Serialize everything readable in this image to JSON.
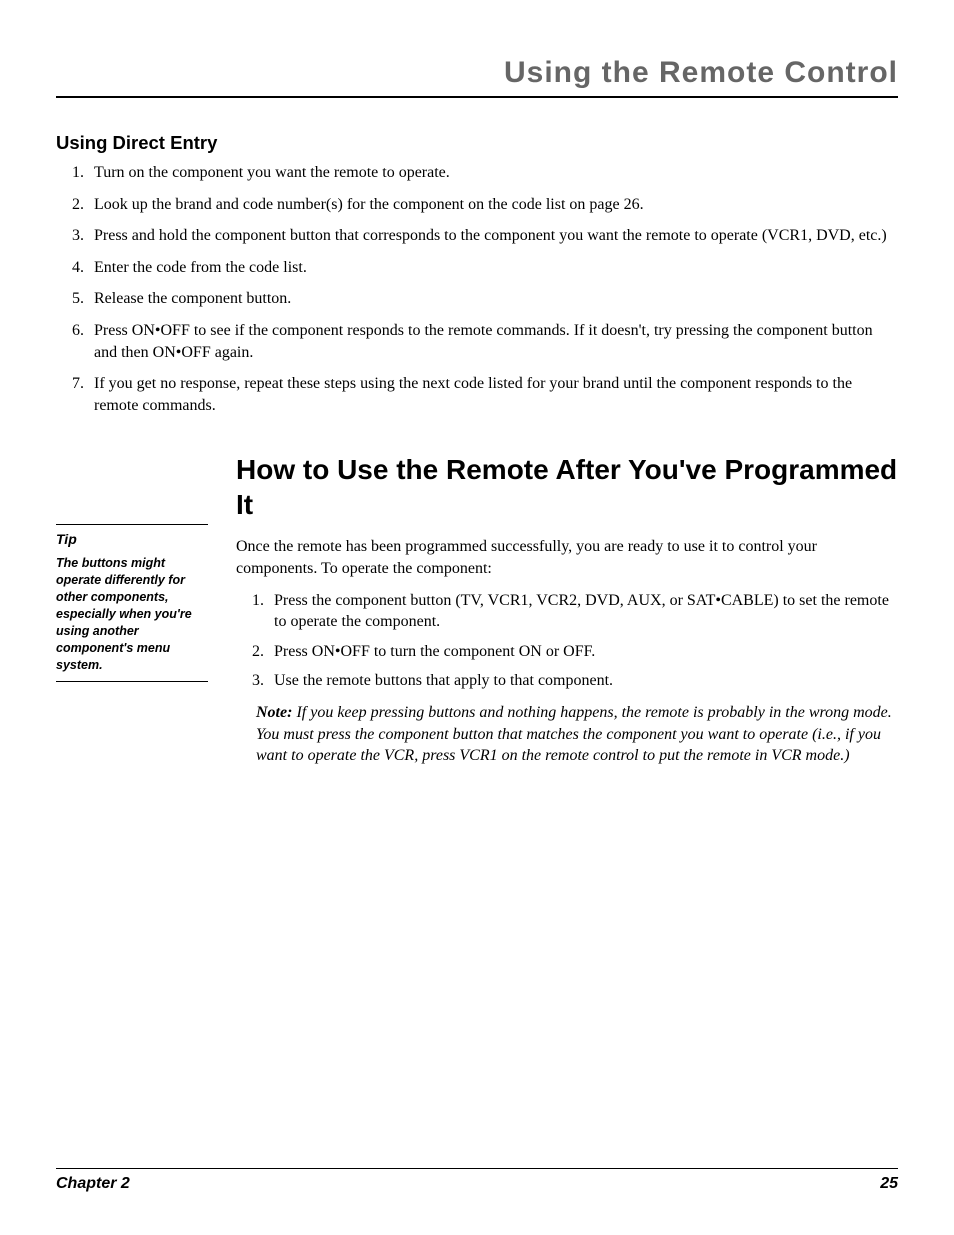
{
  "header": {
    "title": "Using the Remote Control"
  },
  "section1": {
    "heading": "Using Direct Entry",
    "items": [
      "Turn on the component you want the remote to operate.",
      "Look up the brand and code number(s) for the component on the code list on page 26.",
      "Press and hold the component button that corresponds to the component you want the remote to operate (VCR1, DVD, etc.)",
      "Enter the code from the code list.",
      "Release the component button.",
      "Press ON•OFF to see if the component responds to the remote commands. If it doesn't, try pressing the component button and then ON•OFF again.",
      "If you get no response, repeat these steps using the next code listed for your brand until the component responds to the remote commands."
    ]
  },
  "tip": {
    "heading": "Tip",
    "body": "The buttons might operate differently for other components, especially when you're using another component's menu system."
  },
  "section2": {
    "heading": "How to Use the Remote After You've Programmed It",
    "intro": "Once the remote has been programmed successfully, you are ready to use it to control your components. To operate the component:",
    "items": [
      "Press the component button (TV, VCR1, VCR2, DVD, AUX, or SAT•CABLE) to set the remote to operate the component.",
      "Press ON•OFF to turn the component ON or OFF.",
      "Use the remote buttons that apply to that component."
    ],
    "note_label": "Note:",
    "note_body": " If you keep pressing buttons and nothing happens, the remote is probably in the wrong mode. You must press the component button that matches the component you want to operate (i.e., if you want to operate the VCR, press VCR1 on the remote control to put the remote in VCR mode.)"
  },
  "footer": {
    "chapter": "Chapter 2",
    "page": "25"
  }
}
